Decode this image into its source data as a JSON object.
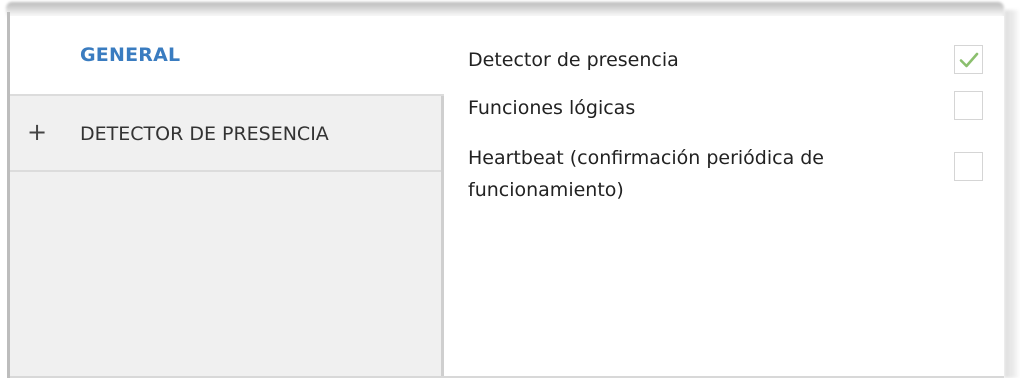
{
  "sidebar": {
    "items": [
      {
        "label": "GENERAL",
        "prefix": ""
      },
      {
        "label": "DETECTOR DE PRESENCIA",
        "prefix": "+"
      }
    ]
  },
  "content": {
    "options": [
      {
        "label": "Detector de presencia",
        "checked": true
      },
      {
        "label": "Funciones lógicas",
        "checked": false
      },
      {
        "label": "Heartbeat (confirmación periódica de funcionamiento)",
        "checked": false
      }
    ]
  },
  "colors": {
    "selected_label": "#3a7cc0",
    "check_mark": "#8bbf6e"
  },
  "icons": {
    "expand": "plus-icon",
    "checked": "check-icon"
  }
}
